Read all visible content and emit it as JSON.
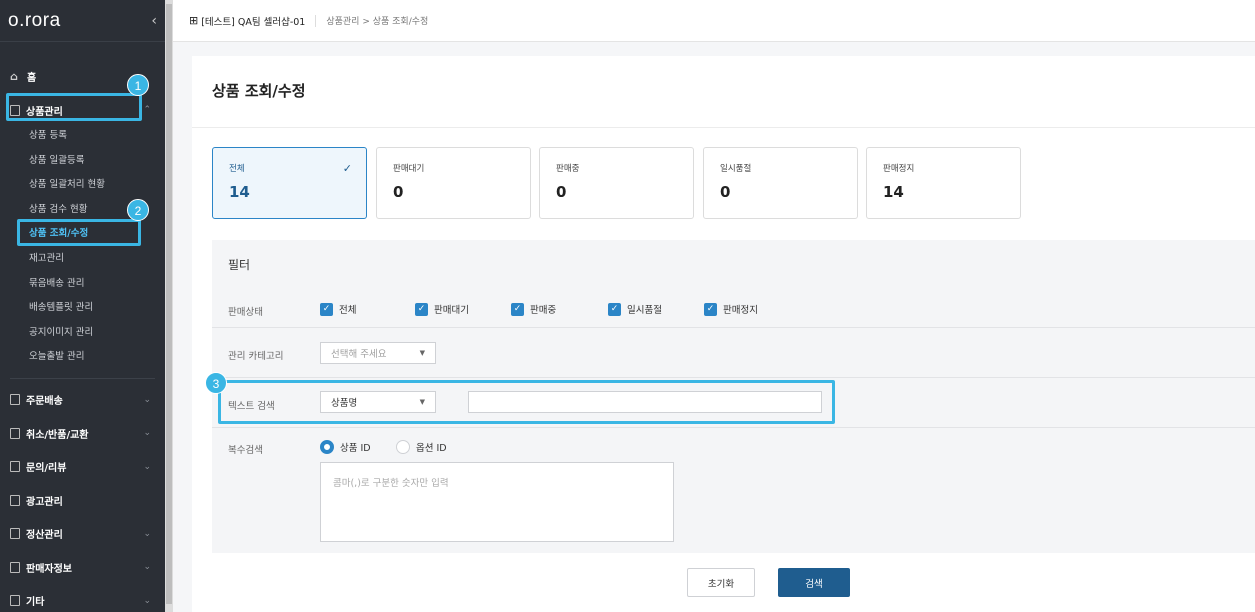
{
  "sidebar": {
    "logo": "o.rora",
    "collapse_icon": "‹",
    "home": "홈",
    "product_section": "상품관리",
    "product_sub": [
      "상품 등록",
      "상품 일괄등록",
      "상품 일괄처리 현황",
      "상품 검수 현황",
      "상품 조회/수정",
      "재고관리",
      "묶음배송 관리",
      "배송템플릿 관리",
      "공지이미지 관리",
      "오늘출발 관리"
    ],
    "sections": [
      "주문배송",
      "취소/반품/교환",
      "문의/리뷰",
      "광고관리",
      "정산관리",
      "판매자정보",
      "기타"
    ]
  },
  "annotations": [
    "1",
    "2",
    "3"
  ],
  "topbar": {
    "store": "[테스트] QA팀 셀러샵-01",
    "breadcrumb": "상품관리 > 상품 조회/수정"
  },
  "page": {
    "title": "상품 조회/수정"
  },
  "stats": [
    {
      "label": "전체",
      "value": "14",
      "active": true
    },
    {
      "label": "판매대기",
      "value": "0"
    },
    {
      "label": "판매중",
      "value": "0"
    },
    {
      "label": "일시품절",
      "value": "0"
    },
    {
      "label": "판매정지",
      "value": "14"
    }
  ],
  "filter": {
    "title": "필터",
    "status_label": "판매상태",
    "status_options": [
      "전체",
      "판매대기",
      "판매중",
      "일시품절",
      "판매정지"
    ],
    "category_label": "관리 카테고리",
    "category_placeholder": "선택해 주세요",
    "text_search_label": "텍스트 검색",
    "text_search_type": "상품명",
    "multi_search_label": "복수검색",
    "radio_product_id": "상품 ID",
    "radio_option_id": "옵션 ID",
    "textarea_placeholder": "콤마(,)로 구분한 숫자만 입력"
  },
  "buttons": {
    "reset": "초기화",
    "search": "검색"
  },
  "colors": {
    "accent": "#3ab6e4",
    "primary": "#1f5d8f",
    "sidebar": "#2b2f36"
  }
}
